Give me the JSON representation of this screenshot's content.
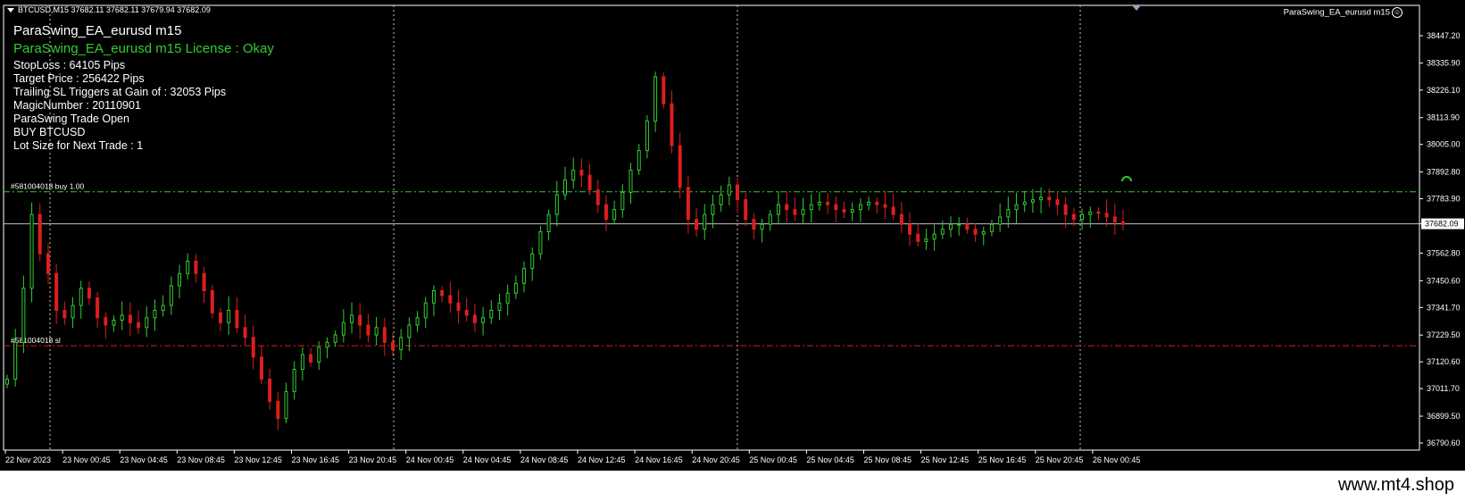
{
  "window": {
    "symbol_line": "BTCUSD,M15  37682.11 37682.11 37679.94 37682.09"
  },
  "ea": {
    "title": "ParaSwing_EA_eurusd m15",
    "license": "ParaSwing_EA_eurusd m15 License : Okay",
    "badge": "ParaSwing_EA_eurusd m15",
    "info_lines": [
      "StopLoss : 64105 Pips",
      "Target Price : 256422 Pips",
      "Trailing SL Triggers at Gain of : 32053 Pips",
      "MagicNumber : 20110901",
      "ParaSwing Trade Open",
      "BUY BTCUSD",
      "Lot Size for Next Trade : 1"
    ]
  },
  "order_lines": {
    "buy_label": "#581004018 buy 1.00",
    "sl_label": "#581004018 sl",
    "buy_price": 37812.5,
    "sl_price": 37186.0
  },
  "current_price": {
    "value": 37682.09,
    "label": "37682.09"
  },
  "colors": {
    "background": "#000000",
    "bull": "#32cd32",
    "bear": "#dc1e1e",
    "grid": "#c8c8c8",
    "buy_line": "#32cd32",
    "sl_line": "#dc1e1e",
    "bid_line": "#c0c0c0",
    "license_text": "#32cd32"
  },
  "chart_data": {
    "type": "candlestick",
    "y_ticks": [
      "38447.20",
      "38335.90",
      "38226.10",
      "38113.90",
      "38005.00",
      "37892.80",
      "37783.90",
      "37682.09",
      "37562.80",
      "37450.60",
      "37341.70",
      "37229.50",
      "37120.60",
      "37011.70",
      "36899.50",
      "36790.60"
    ],
    "y_tick_values": [
      38447.2,
      38335.9,
      38226.1,
      38113.9,
      38005.0,
      37892.8,
      37783.9,
      37682.09,
      37562.8,
      37450.6,
      37341.7,
      37229.5,
      37120.6,
      37011.7,
      36899.5,
      36790.6
    ],
    "ylim": [
      36790.6,
      38447.2
    ],
    "x_ticks": [
      "22 Nov 2023",
      "23 Nov 00:45",
      "23 Nov 04:45",
      "23 Nov 08:45",
      "23 Nov 12:45",
      "23 Nov 16:45",
      "23 Nov 20:45",
      "24 Nov 00:45",
      "24 Nov 04:45",
      "24 Nov 08:45",
      "24 Nov 12:45",
      "24 Nov 16:45",
      "24 Nov 20:45",
      "25 Nov 00:45",
      "25 Nov 04:45",
      "25 Nov 08:45",
      "25 Nov 12:45",
      "25 Nov 16:45",
      "25 Nov 20:45",
      "26 Nov 00:45"
    ],
    "close_series": [
      37050,
      37200,
      37420,
      37720,
      37560,
      37480,
      37330,
      37300,
      37350,
      37420,
      37380,
      37300,
      37270,
      37290,
      37310,
      37280,
      37260,
      37300,
      37330,
      37350,
      37430,
      37480,
      37530,
      37480,
      37410,
      37320,
      37280,
      37330,
      37260,
      37220,
      37140,
      37050,
      36960,
      36890,
      37000,
      37090,
      37150,
      37120,
      37180,
      37200,
      37230,
      37280,
      37310,
      37270,
      37230,
      37260,
      37200,
      37170,
      37220,
      37270,
      37300,
      37360,
      37410,
      37390,
      37360,
      37330,
      37310,
      37280,
      37300,
      37330,
      37360,
      37400,
      37440,
      37500,
      37560,
      37650,
      37720,
      37800,
      37860,
      37900,
      37880,
      37820,
      37760,
      37700,
      37740,
      37810,
      37900,
      37980,
      38100,
      38280,
      38170,
      38000,
      37830,
      37700,
      37660,
      37720,
      37760,
      37800,
      37840,
      37780,
      37700,
      37660,
      37680,
      37720,
      37760,
      37740,
      37720,
      37740,
      37760,
      37770,
      37760,
      37740,
      37730,
      37740,
      37760,
      37770,
      37760,
      37750,
      37720,
      37680,
      37640,
      37610,
      37620,
      37640,
      37660,
      37680,
      37680,
      37660,
      37640,
      37650,
      37680,
      37710,
      37740,
      37760,
      37770,
      37780,
      37790,
      37780,
      37760,
      37720,
      37700,
      37720,
      37730,
      37725,
      37710,
      37690,
      37680
    ]
  },
  "footer": {
    "watermark": "www.mt4.shop"
  }
}
